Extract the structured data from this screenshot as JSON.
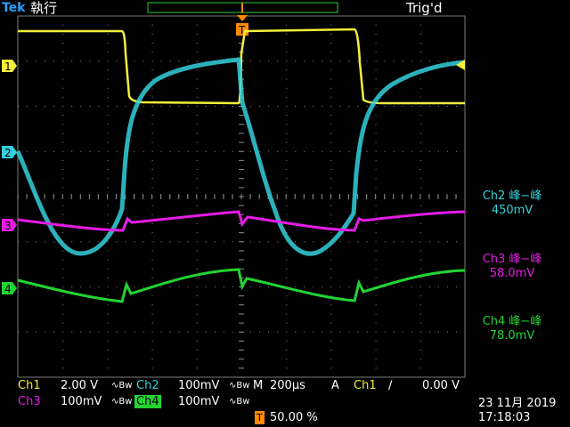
{
  "header": {
    "brand": "Tek",
    "run_state": "執行",
    "trigger_status": "Trig'd",
    "trigger_marker": "T"
  },
  "channels": [
    {
      "id": "1",
      "color": "#f5ee3a",
      "scale": "2.00 V",
      "coupling": "∿Bw"
    },
    {
      "id": "2",
      "color": "#34d0dc",
      "scale": "100mV",
      "coupling": "∿Bw"
    },
    {
      "id": "3",
      "color": "#e61be6",
      "scale": "100mV",
      "coupling": "∿Bw"
    },
    {
      "id": "4",
      "color": "#22d432",
      "scale": "100mV",
      "coupling": "∿Bw"
    }
  ],
  "status_bar": {
    "ch1_label": "Ch1",
    "ch2_label": "Ch2",
    "ch3_label": "Ch3",
    "ch4_label": "Ch4",
    "timebase_label": "M",
    "timebase": "200µs",
    "trigger_mode": "A",
    "trigger_source": "Ch1",
    "trigger_slope": "∕",
    "trigger_level": "0.00 V",
    "trigger_position": "50.00 %",
    "date": "23 11月 2019",
    "time": "17:18:03"
  },
  "measurements": [
    {
      "name": "Ch2 峰−峰",
      "value": "450mV",
      "color": "#34d0dc"
    },
    {
      "name": "Ch3 峰−峰",
      "value": "58.0mV",
      "color": "#e61be6"
    },
    {
      "name": "Ch4 峰−峰",
      "value": "78.0mV",
      "color": "#22d432"
    }
  ]
}
